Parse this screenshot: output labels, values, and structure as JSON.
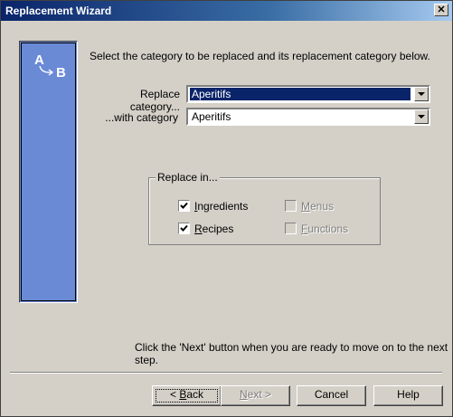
{
  "window": {
    "title": "Replacement Wizard",
    "close_glyph": "✕"
  },
  "sidepanel": {
    "icon": "a-to-b-replace-icon",
    "letter_a": "A",
    "letter_b": "B",
    "color": "#6a8ad6"
  },
  "instruction": "Select the category to be replaced and its replacement category below.",
  "replace_category": {
    "label": "Replace category...",
    "value": "Aperitifs"
  },
  "with_category": {
    "label": "...with category",
    "value": "Aperitifs"
  },
  "replace_in": {
    "legend": "Replace in...",
    "options": [
      {
        "label_first": "I",
        "label_rest": "ngredients",
        "checked": true,
        "enabled": true
      },
      {
        "label_first": "R",
        "label_rest": "ecipes",
        "checked": true,
        "enabled": true
      },
      {
        "label_first": "M",
        "label_rest": "enus",
        "checked": false,
        "enabled": false
      },
      {
        "label_first": "F",
        "label_rest": "unctions",
        "checked": false,
        "enabled": false
      }
    ]
  },
  "footer_text": "Click the 'Next' button when you are ready to move on to the next step.",
  "buttons": {
    "back_prefix": "< ",
    "back_first": "B",
    "back_rest": "ack",
    "next_first": "N",
    "next_rest": "ext >",
    "cancel": "Cancel",
    "help": "Help"
  }
}
